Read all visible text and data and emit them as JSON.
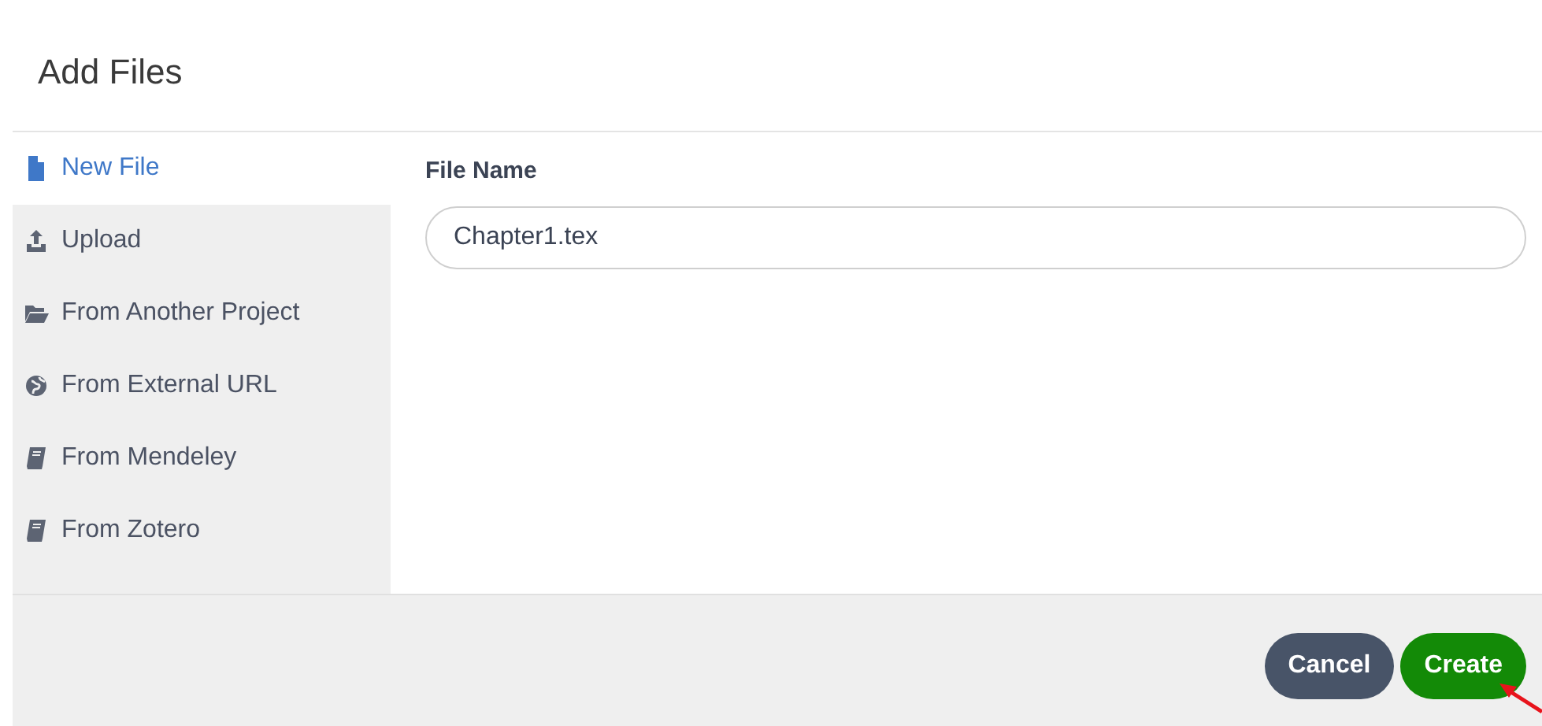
{
  "dialog": {
    "title": "Add Files"
  },
  "sidebar": {
    "items": [
      {
        "label": "New File",
        "kind": "file",
        "selected": true
      },
      {
        "label": "Upload",
        "kind": "upload",
        "selected": false
      },
      {
        "label": "From Another Project",
        "kind": "folder",
        "selected": false
      },
      {
        "label": "From External URL",
        "kind": "globe",
        "selected": false
      },
      {
        "label": "From Mendeley",
        "kind": "book",
        "selected": false
      },
      {
        "label": "From Zotero",
        "kind": "book",
        "selected": false
      }
    ]
  },
  "form": {
    "label": "File Name",
    "value": "Chapter1.tex"
  },
  "buttons": [
    {
      "label": "Cancel",
      "kind": "secondary"
    },
    {
      "label": "Create",
      "kind": "primary"
    }
  ]
}
